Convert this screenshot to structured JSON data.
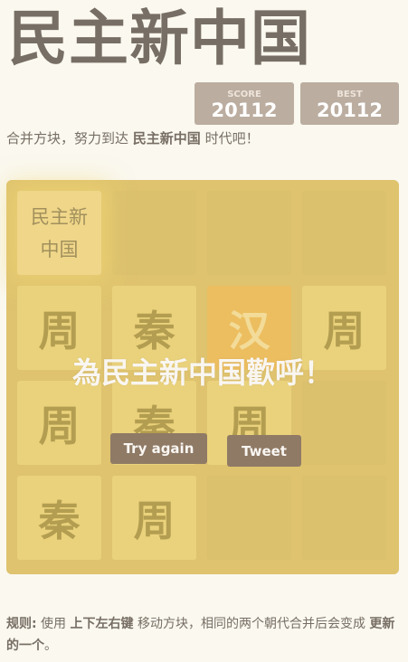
{
  "header": {
    "title": "民主新中国",
    "score_label": "SCORE",
    "score_value": "20112",
    "best_label": "BEST",
    "best_value": "20112"
  },
  "intro": {
    "text_before": "合并方块，努力到达 ",
    "highlight": "民主新中国",
    "text_after": " 时代吧！"
  },
  "board": {
    "size": 4,
    "tiles": [
      [
        "民主新中国",
        "",
        "",
        ""
      ],
      [
        "周",
        "秦",
        "汉",
        "周"
      ],
      [
        "周",
        "秦",
        "周",
        ""
      ],
      [
        "秦",
        "周",
        "",
        ""
      ]
    ]
  },
  "game_over": {
    "message": "為民主新中国歡呼！",
    "retry_label": "Try again",
    "tweet_label": "Tweet"
  },
  "rules": {
    "label": "规则:",
    "t1": " 使用 ",
    "keys": "上下左右键",
    "t2": " 移动方块，相同的两个朝代合并后会变成 ",
    "newer": "更新的一个",
    "t3": "。"
  },
  "colors": {
    "background": "#faf8ef",
    "board": "#dbbf6d",
    "button": "#8f7a66",
    "score_box": "#bbada0",
    "tile_han": "#ecb95a"
  }
}
